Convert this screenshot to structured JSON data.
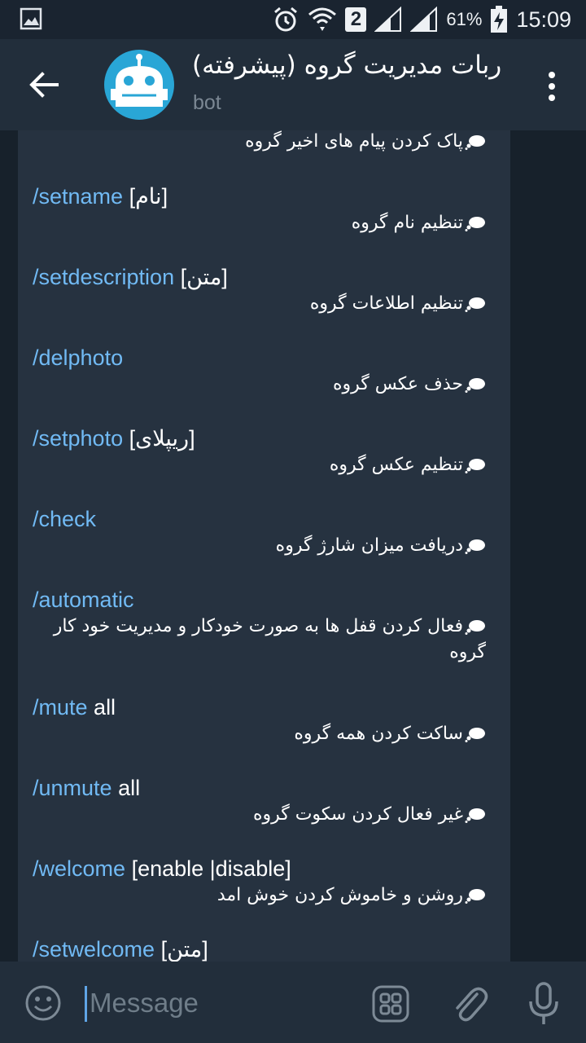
{
  "status_bar": {
    "sim_slot": "2",
    "battery_percent": "61%",
    "time": "15:09"
  },
  "header": {
    "title": "ربات مدیریت گروه (پیشرفته)",
    "subtitle": "bot"
  },
  "messages": [
    {
      "cmd": "",
      "arg": "",
      "desc": "پاک کردن پیام های اخیر گروه"
    },
    {
      "cmd": "/setname",
      "arg": "[نام]",
      "desc": "تنظیم نام گروه"
    },
    {
      "cmd": "/setdescription",
      "arg": "[متن]",
      "desc": "تنظیم اطلاعات گروه"
    },
    {
      "cmd": "/delphoto",
      "arg": "",
      "desc": "حذف عکس گروه"
    },
    {
      "cmd": "/setphoto",
      "arg": "[ریپلای]",
      "desc": "تنظیم عکس گروه"
    },
    {
      "cmd": "/check",
      "arg": "",
      "desc": "دریافت میزان شارژ گروه"
    },
    {
      "cmd": "/automatic",
      "arg": "",
      "desc": "فعال کردن قفل ها به صورت خودکار و مدیریت خود کار گروه"
    },
    {
      "cmd": "/mute",
      "arg": "all",
      "desc": "ساکت کردن همه گروه"
    },
    {
      "cmd": "/unmute",
      "arg": "all",
      "desc": "غیر فعال کردن سکوت گروه"
    },
    {
      "cmd": "/welcome",
      "arg": "[enable |disable]",
      "desc": "روشن و خاموش کردن خوش امد"
    },
    {
      "cmd": "/setwelcome",
      "arg": "[متن]",
      "desc": ""
    }
  ],
  "input": {
    "placeholder": "Message"
  },
  "colors": {
    "command": "#71baf4",
    "header_bg": "#222e3b",
    "bubble_bg": "#263240",
    "chat_bg": "#17212b"
  }
}
